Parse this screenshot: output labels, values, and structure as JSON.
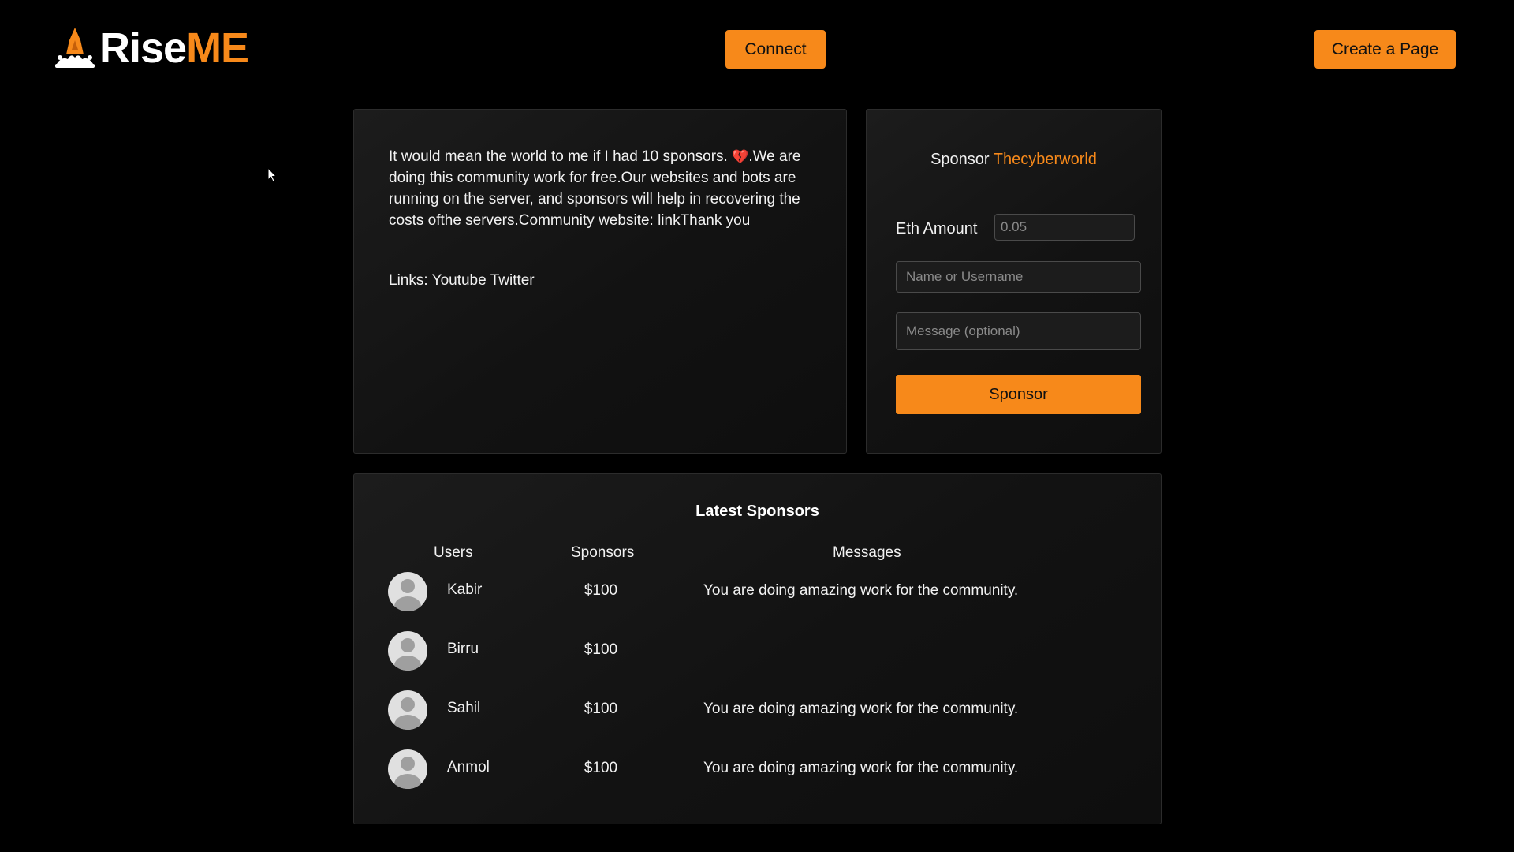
{
  "header": {
    "logo_rise": "Rise",
    "logo_me": "ME",
    "connect_label": "Connect",
    "create_label": "Create a Page"
  },
  "about": {
    "text_before_heart": "It would mean the world to me if I had 10 sponsors. ",
    "heart": "💔",
    "text_after_heart": ".We are doing this community work for free.Our websites and bots are running on the server, and sponsors will help in recovering the costs ofthe servers.Community website: linkThank you",
    "links_label": "Links:",
    "link_youtube": "Youtube",
    "link_twitter": "Twitter"
  },
  "sponsor_form": {
    "title_prefix": "Sponsor",
    "creator_name": "Thecyberworld",
    "eth_label": "Eth Amount",
    "eth_placeholder": "0.05",
    "name_placeholder": "Name or Username",
    "message_placeholder": "Message (optional)",
    "submit_label": "Sponsor"
  },
  "latest": {
    "title": "Latest Sponsors",
    "columns": {
      "users": "Users",
      "sponsors": "Sponsors",
      "messages": "Messages"
    },
    "rows": [
      {
        "user": "Kabir",
        "amount": "$100",
        "message": "You are doing amazing work for the community."
      },
      {
        "user": "Birru",
        "amount": "$100",
        "message": ""
      },
      {
        "user": "Sahil",
        "amount": "$100",
        "message": "You are doing amazing work for the community."
      },
      {
        "user": "Anmol",
        "amount": "$100",
        "message": "You are doing amazing work for the community."
      }
    ]
  },
  "colors": {
    "accent": "#f7891a",
    "background": "#000000",
    "card": "#161616"
  },
  "icons": {
    "logo": "rocket-flame-icon",
    "avatar": "default-user-icon",
    "cursor": "mouse-pointer-icon"
  }
}
